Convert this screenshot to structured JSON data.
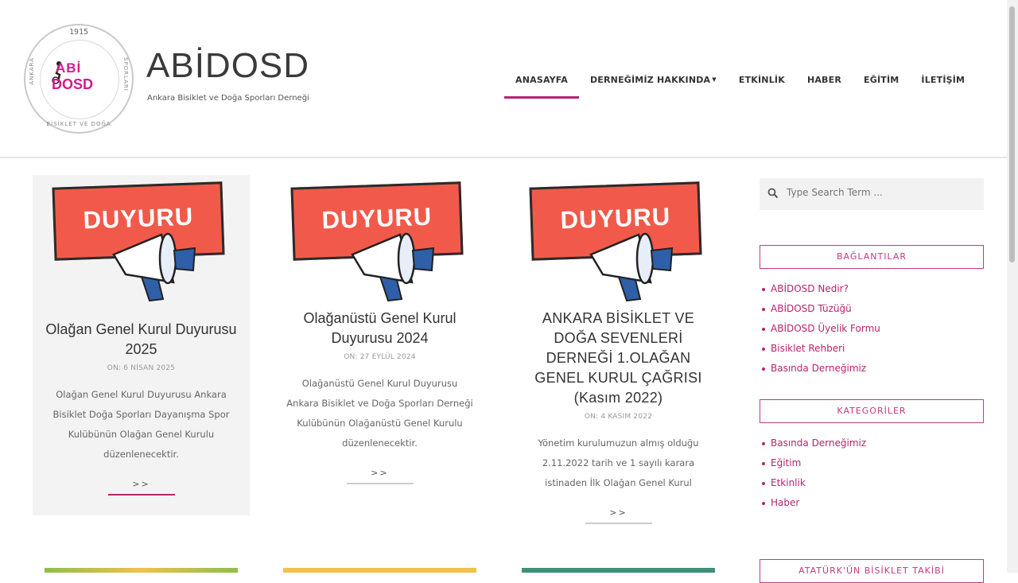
{
  "header": {
    "site_title": "ABİDOSD",
    "tagline": "Ankara Bisiklet ve Doğa Sporları Derneği",
    "logo": {
      "year": "1915",
      "abi": "ABİ",
      "dosd": "DOSD",
      "ring_left": "ANKARA",
      "ring_right": "SPORLARI",
      "ring_bottom": "BİSİKLET VE DOĞA"
    }
  },
  "nav": {
    "items": [
      {
        "label": "ANASAYFA"
      },
      {
        "label": "DERNEĞİMİZ HAKKINDA"
      },
      {
        "label": "ETKİNLİK"
      },
      {
        "label": "HABER"
      },
      {
        "label": "EĞİTİM"
      },
      {
        "label": "İLETİŞİM"
      }
    ],
    "active_index": 0
  },
  "posts": [
    {
      "image_text": "DUYURU",
      "title": "Olağan Genel Kurul Duyurusu 2025",
      "date": "ON: 6 NİSAN 2025",
      "excerpt": "Olağan Genel Kurul Duyurusu Ankara Bisiklet Doğa Sporları Dayanışma Spor Kulübünün Olağan Genel Kurulu düzenlenecektir.",
      "more": ">>"
    },
    {
      "image_text": "DUYURU",
      "title": "Olağanüstü Genel Kurul Duyurusu 2024",
      "date": "ON: 27 EYLÜL 2024",
      "excerpt": "Olağanüstü Genel Kurul Duyurusu Ankara Bisiklet ve Doğa Sporları Derneği Kulübünün Olağanüstü Genel Kurulu düzenlenecektir.",
      "more": ">>"
    },
    {
      "image_text": "DUYURU",
      "title": "ANKARA BİSİKLET VE DOĞA SEVENLERİ DERNEĞİ 1.OLAĞAN GENEL KURUL ÇAĞRISI (Kasım 2022)",
      "date": "ON: 4 KASIM 2022",
      "excerpt": "Yönetim kurulumuzun almış olduğu 2.11.2022 tarih ve 1 sayılı karara istinaden İlk Olağan Genel Kurul",
      "more": ">>"
    }
  ],
  "sidebar": {
    "search_placeholder": "Type Search Term ...",
    "widgets": [
      {
        "title": "BAĞLANTILAR",
        "links": [
          "ABİDOSD Nedir?",
          "ABİDOSD Tüzüğü",
          "ABİDOSD Üyelik Formu",
          "Bisiklet Rehberi",
          "Basında Derneğimiz"
        ]
      },
      {
        "title": "KATEGORİLER",
        "links": [
          "Basında Derneğimiz",
          "Eğitim",
          "Etkinlik",
          "Haber"
        ]
      },
      {
        "title": "ATATÜRK'ÜN BİSİKLET TAKİBİ",
        "links": []
      }
    ]
  },
  "colors": {
    "accent": "#b7236f",
    "banner": "#f15a4a",
    "card_bg": "#f3f3f3"
  }
}
